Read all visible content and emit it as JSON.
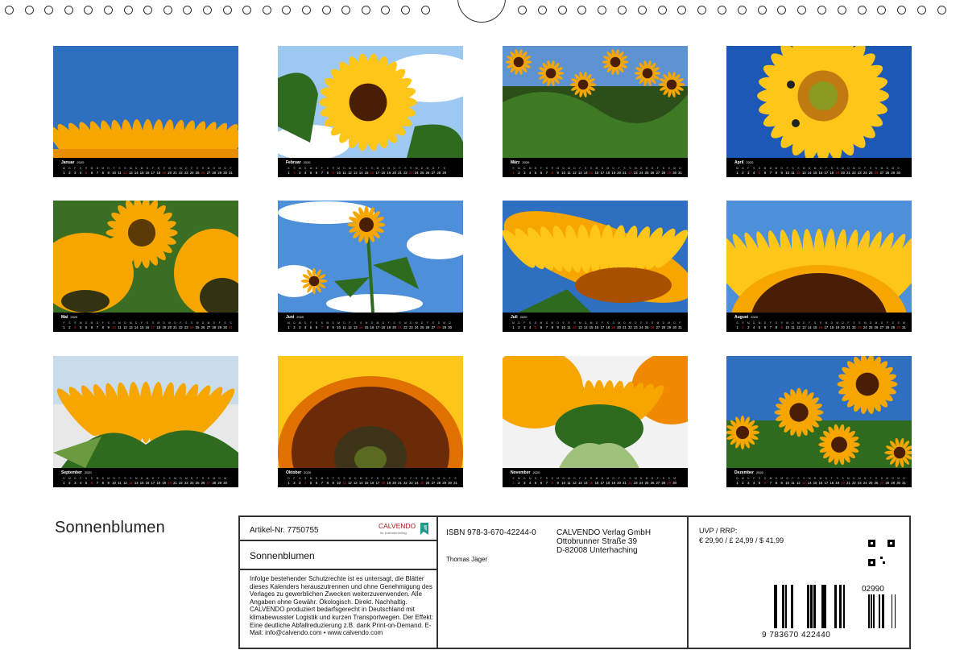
{
  "calendar_title": "Sonnenblumen",
  "year": "2020",
  "weekday_letters": [
    "M",
    "D",
    "M",
    "D",
    "F",
    "S",
    "S",
    "M",
    "D",
    "M",
    "D",
    "F",
    "S",
    "S",
    "M",
    "D",
    "M",
    "D",
    "F",
    "S",
    "S",
    "M",
    "D",
    "M",
    "D",
    "F",
    "S",
    "S",
    "M",
    "D",
    "M"
  ],
  "months": [
    {
      "name": "Januar",
      "photo": "petals-sky-low",
      "days": 31,
      "start": 2
    },
    {
      "name": "Februar",
      "photo": "sunflower-clouds",
      "days": 29,
      "start": 5
    },
    {
      "name": "März",
      "photo": "field-from-below",
      "days": 31,
      "start": 6
    },
    {
      "name": "April",
      "photo": "sunflower-bees",
      "days": 30,
      "start": 2
    },
    {
      "name": "Mai",
      "photo": "sunflower-backlit",
      "days": 31,
      "start": 4
    },
    {
      "name": "Juni",
      "photo": "tall-sunflower-clouds",
      "days": 30,
      "start": 0
    },
    {
      "name": "Juli",
      "photo": "sunflower-side",
      "days": 31,
      "start": 2
    },
    {
      "name": "August",
      "photo": "sunflower-half-top",
      "days": 31,
      "start": 5
    },
    {
      "name": "September",
      "photo": "bud-opening",
      "days": 30,
      "start": 1
    },
    {
      "name": "Oktober",
      "photo": "seed-head-closeup",
      "days": 31,
      "start": 3
    },
    {
      "name": "November",
      "photo": "sunflower-back-view",
      "days": 30,
      "start": 6
    },
    {
      "name": "Dezember",
      "photo": "sunflower-field",
      "days": 31,
      "start": 1
    }
  ],
  "info": {
    "article_label": "Artikel-Nr. 7750755",
    "logo_text": "CALVENDO",
    "logo_sub": "Ihr Kalenderverlag",
    "title": "Sonnenblumen",
    "legal_text": "Infolge bestehender Schutzrechte ist es untersagt, die Blätter dieses Kalenders herauszutrennen und ohne Genehmigung des Verlages zu gewerblichen Zwecken weiterzuverwenden. Alle Angaben ohne Gewähr. Ökologisch. Direkt. Nachhaltig. CALVENDO produziert bedarfsgerecht in Deutschland mit klimabewusster Logistik und kurzen Transportwegen. Der Effekt: Eine deutliche Abfallreduzierung z.B. dank Print-on-Demand. E-Mail: info@calvendo.com • www.calvendo.com",
    "isbn": "ISBN 978-3-670-42244-0",
    "author": "Thomas Jäger",
    "publisher_line1": "CALVENDO Verlag GmbH",
    "publisher_line2": "Ottobrunner Straße 39",
    "publisher_line3": "D-82008 Unterhaching",
    "price_label": "UVP / RRP:",
    "price_values": "€ 29,90 / £ 24,99 / $ 41,99",
    "barcode_digits": "9 783670 422440",
    "barcode_addon": "02990"
  },
  "colors": {
    "sky": "#2f6fc0",
    "petal": "#f7a600",
    "sunday": "#d22"
  }
}
